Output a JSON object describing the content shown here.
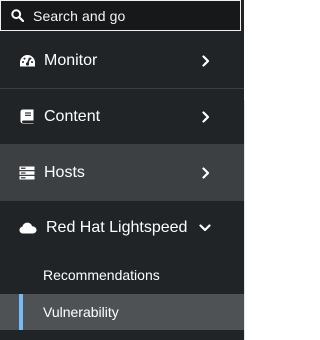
{
  "search": {
    "label": "Search and go",
    "icon": "search-icon"
  },
  "nav": {
    "items": [
      {
        "label": "Monitor",
        "icon": "dashboard-icon",
        "expanded": false
      },
      {
        "label": "Content",
        "icon": "book-icon",
        "expanded": false
      },
      {
        "label": "Hosts",
        "icon": "server-icon",
        "expanded": false,
        "active": true
      },
      {
        "label": "Red Hat Lightspeed",
        "icon": "cloud-icon",
        "expanded": true,
        "children": [
          {
            "label": "Recommendations",
            "active": false
          },
          {
            "label": "Vulnerability",
            "active": true
          }
        ]
      }
    ]
  },
  "colors": {
    "sidebar_bg": "#212427",
    "active_bg": "#3c4042",
    "sub_active_bg": "#4f5255",
    "accent": "#73bcf7",
    "text": "#ffffff"
  }
}
